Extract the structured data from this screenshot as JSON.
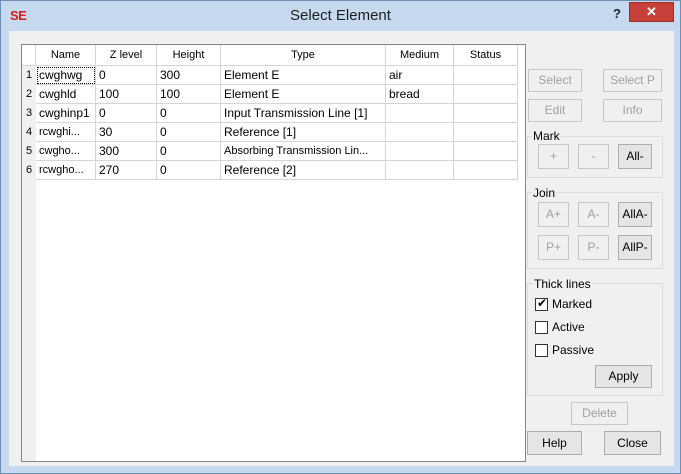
{
  "window": {
    "app_icon": "SE",
    "title": "Select Element",
    "help_glyph": "?",
    "close_glyph": "✕"
  },
  "table": {
    "columns": [
      "Name",
      "Z level",
      "Height",
      "Type",
      "Medium",
      "Status"
    ],
    "rows": [
      {
        "num": "1",
        "name": "cwghwg",
        "z": "0",
        "height": "300",
        "type": "Element E",
        "medium": "air",
        "status": ""
      },
      {
        "num": "2",
        "name": "cwghld",
        "z": "100",
        "height": "100",
        "type": "Element E",
        "medium": "bread",
        "status": ""
      },
      {
        "num": "3",
        "name": "cwghinp1",
        "z": "0",
        "height": "0",
        "type": "Input Transmission Line [1]",
        "medium": "",
        "status": ""
      },
      {
        "num": "4",
        "name": "rcwghi...",
        "z": "30",
        "height": "0",
        "type": "Reference [1]",
        "medium": "",
        "status": ""
      },
      {
        "num": "5",
        "name": "cwgho...",
        "z": "300",
        "height": "0",
        "type": "Absorbing Transmission Lin...",
        "medium": "",
        "status": ""
      },
      {
        "num": "6",
        "name": "rcwgho...",
        "z": "270",
        "height": "0",
        "type": "Reference [2]",
        "medium": "",
        "status": ""
      }
    ]
  },
  "buttons": {
    "select": "Select",
    "select_p": "Select P",
    "edit": "Edit",
    "info": "Info",
    "delete": "Delete",
    "help": "Help",
    "close": "Close",
    "apply": "Apply"
  },
  "mark": {
    "label": "Mark",
    "plus": "+",
    "minus": "-",
    "all_minus": "All-"
  },
  "join": {
    "label": "Join",
    "a_plus": "A+",
    "a_minus": "A-",
    "all_a_minus": "AllA-",
    "p_plus": "P+",
    "p_minus": "P-",
    "all_p_minus": "AllP-"
  },
  "thick_lines": {
    "label": "Thick lines",
    "marked": "Marked",
    "active": "Active",
    "passive": "Passive",
    "marked_checked": true,
    "active_checked": false,
    "passive_checked": false,
    "check_glyph": "✔"
  }
}
